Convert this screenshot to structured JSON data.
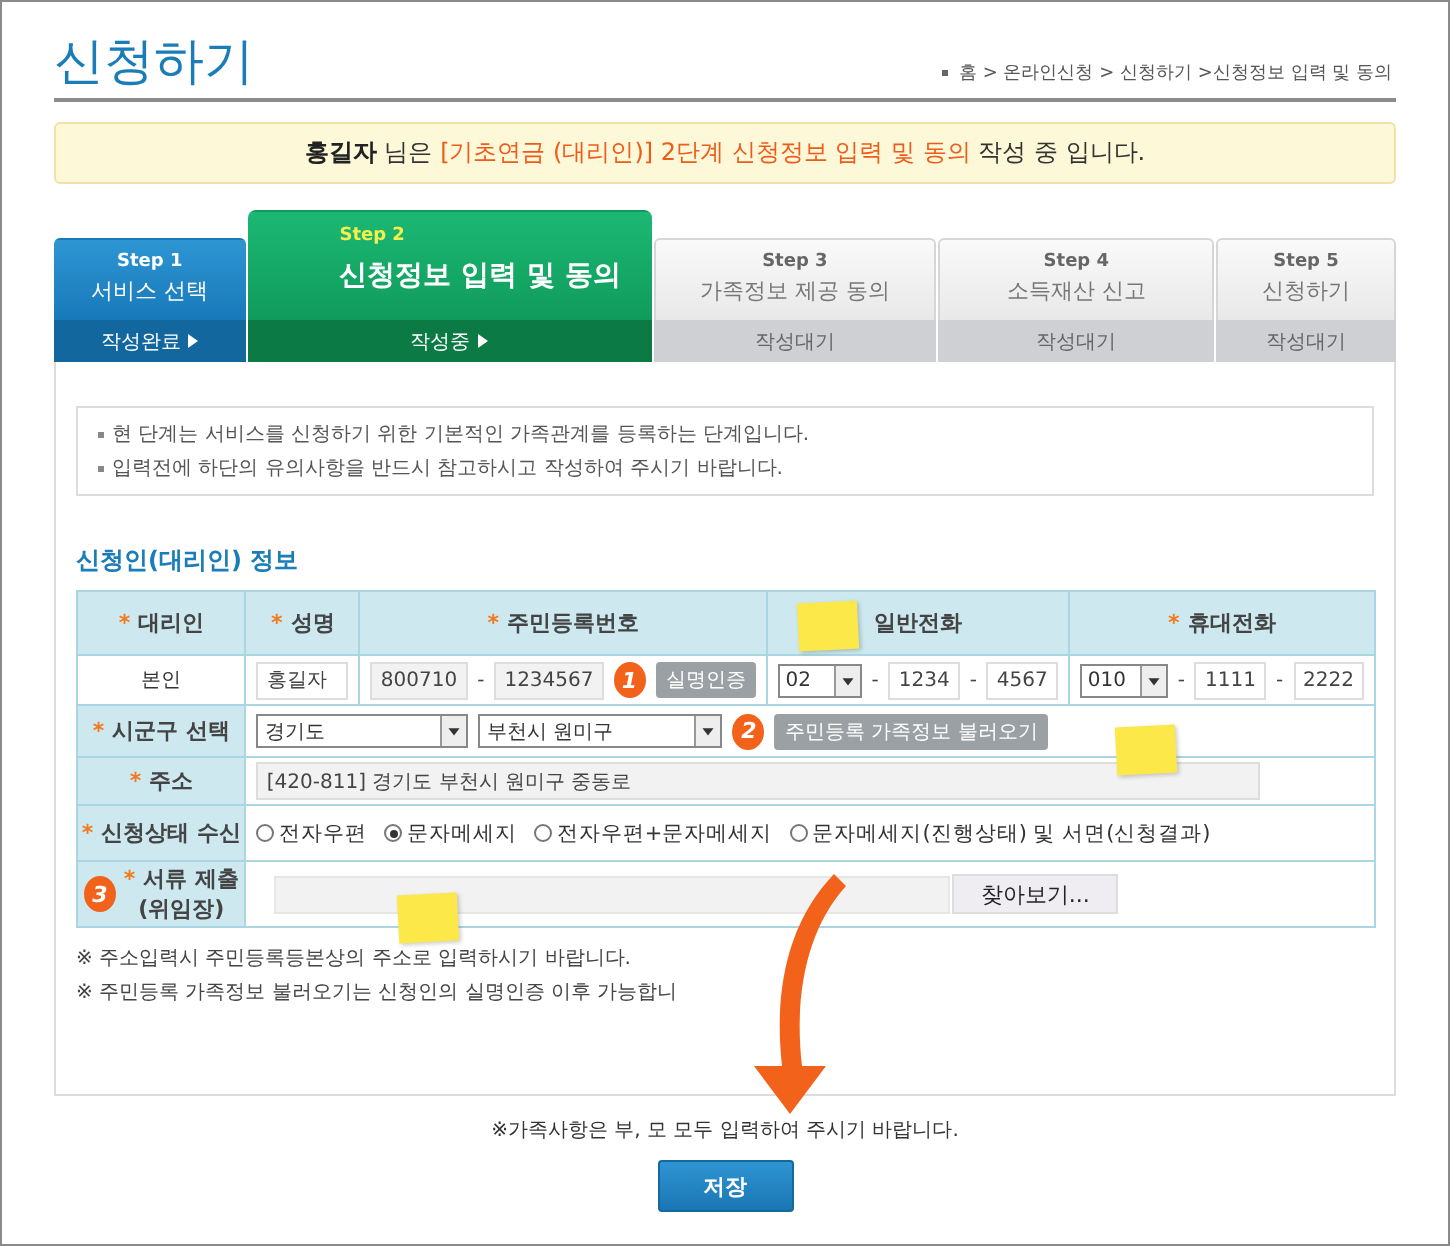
{
  "title": "신청하기",
  "breadcrumb": "홈 > 온라인신청 > 신청하기 >신청정보 입력 및 동의",
  "notice": [
    {
      "kind": "name",
      "text": "홍길자"
    },
    {
      "kind": "plain",
      "text": " 님은 "
    },
    {
      "kind": "highlight",
      "text": "[기초연금 (대리인)] 2단계 신청정보 입력 및 동의"
    },
    {
      "kind": "plain",
      "text": " 작성 중 입니다."
    }
  ],
  "steps": [
    {
      "step": "Step 1",
      "title": "서비스 선택",
      "status": "작성완료",
      "done": true,
      "selected": false
    },
    {
      "step": "Step 2",
      "title": "신청정보 입력 및 동의",
      "status": "작성중",
      "done": false,
      "selected": true
    },
    {
      "step": "Step 3",
      "title": "가족정보 제공 동의",
      "status": "작성대기",
      "done": false,
      "selected": false
    },
    {
      "step": "Step 4",
      "title": "소득재산 신고",
      "status": "작성대기",
      "done": false,
      "selected": false
    },
    {
      "step": "Step 5",
      "title": "신청하기",
      "status": "작성대기",
      "done": false,
      "selected": false
    }
  ],
  "info": [
    "현 단계는 서비스를 신청하기 위한 기본적인 가족관계를 등록하는 단계입니다.",
    "입력전에 하단의 유의사항을 반드시 참고하시고 작성하여 주시기 바랍니다."
  ],
  "section_title": "신청인(대리인) 정보",
  "table": {
    "columns": [
      {
        "mark": "*",
        "label": "대리인"
      },
      {
        "mark": "*",
        "label": "성명"
      },
      {
        "mark": "*",
        "label": "주민등록번호"
      },
      {
        "label": "일반전화"
      },
      {
        "mark": "*",
        "label": "휴대전화"
      }
    ],
    "applicant": {
      "relation": "본인",
      "name": "홍길자",
      "rrn": [
        "800710",
        "1234567"
      ],
      "separator": "-",
      "verify_button": "실명인증",
      "phone": {
        "area": "02",
        "parts": [
          "1234",
          "4567"
        ]
      },
      "mobile": {
        "prefix": "010",
        "parts": [
          "1111",
          "2222"
        ]
      }
    },
    "region": {
      "mark": "*",
      "label": "시군구 선택",
      "province": "경기도",
      "city": "부천시 원미구",
      "button": "주민등록 가족정보 불러오기"
    },
    "address": {
      "mark": "*",
      "label": "주소",
      "value": "[420-811] 경기도 부천시 원미구 중동로"
    },
    "receive": {
      "mark": "*",
      "label": "신청상태 수신",
      "options": [
        {
          "label": "전자우편",
          "selected": false
        },
        {
          "label": "문자메세지",
          "selected": true
        },
        {
          "label": "전자우편+문자메세지",
          "selected": false
        },
        {
          "label": "문자메세지(진행상태) 및 서면(신청결과)",
          "selected": false
        }
      ]
    },
    "documents": {
      "mark": "*",
      "label": "서류 제출",
      "sublabel": "(위임장)",
      "button": "찾아보기..."
    }
  },
  "notes": [
    "※ 주소입력시 주민등록등본상의 주소로 입력하시기 바랍니다.",
    "※ 주민등록 가족정보 불러오기는 신청인의 실명인증 이후 가능합니"
  ],
  "bottom_note": "※가족사항은 부, 모 모두 입력하여 주시기 바랍니다.",
  "save_button": "저장",
  "badges": [
    "1",
    "2",
    "3"
  ]
}
